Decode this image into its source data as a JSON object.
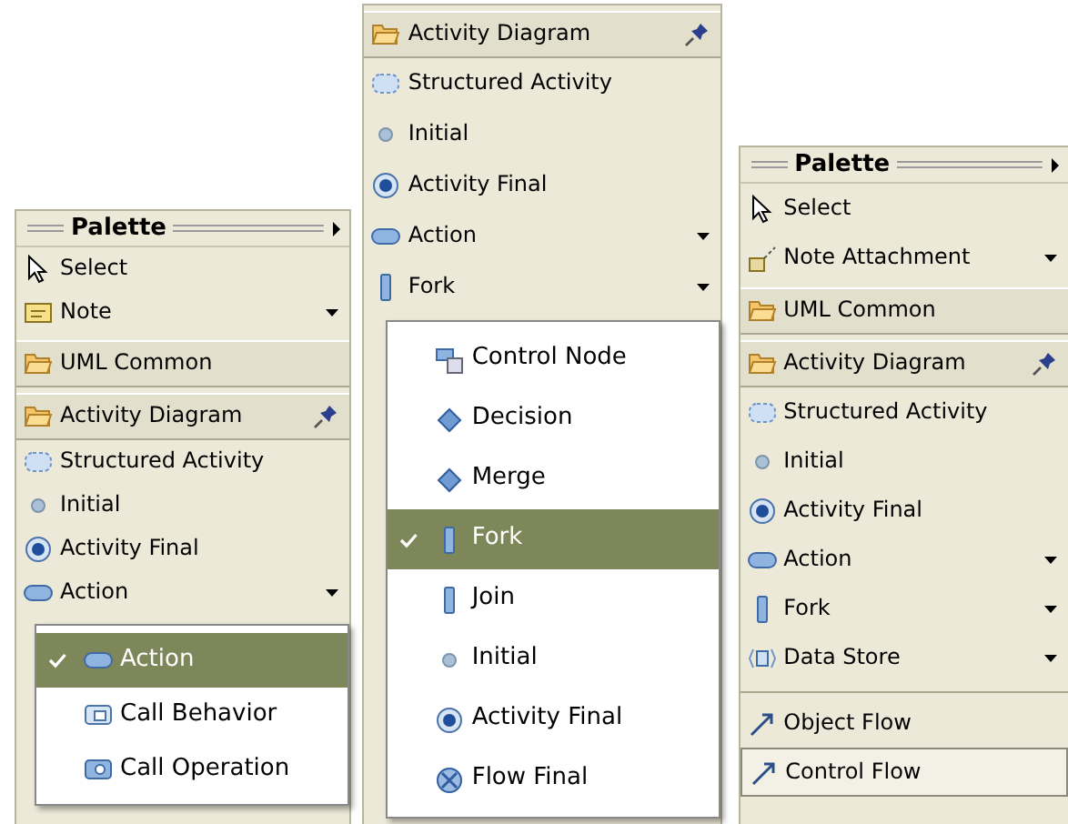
{
  "panels": [
    {
      "title": "Palette",
      "items": [
        {
          "kind": "select",
          "label": "Select",
          "dropdown": false,
          "selected": false
        },
        {
          "kind": "note",
          "label": "Note",
          "dropdown": true,
          "selected": false
        },
        {
          "kind": "drawer",
          "label": "UML Common",
          "pinned": false
        },
        {
          "kind": "drawer",
          "label": "Activity Diagram",
          "pinned": true
        },
        {
          "kind": "structured",
          "label": "Structured Activity",
          "dropdown": false,
          "selected": false
        },
        {
          "kind": "initial",
          "label": "Initial",
          "dropdown": false,
          "selected": false
        },
        {
          "kind": "final",
          "label": "Activity Final",
          "dropdown": false,
          "selected": false
        },
        {
          "kind": "action",
          "label": "Action",
          "dropdown": true,
          "selected": false
        }
      ],
      "menu": [
        {
          "kind": "action",
          "label": "Action",
          "selected": true
        },
        {
          "kind": "call-behavior",
          "label": "Call Behavior",
          "selected": false
        },
        {
          "kind": "call-operation",
          "label": "Call Operation",
          "selected": false
        }
      ]
    },
    {
      "items": [
        {
          "kind": "drawer",
          "label": "Activity Diagram",
          "pinned": true
        },
        {
          "kind": "structured",
          "label": "Structured Activity",
          "dropdown": false,
          "selected": false
        },
        {
          "kind": "initial",
          "label": "Initial",
          "dropdown": false,
          "selected": false
        },
        {
          "kind": "final",
          "label": "Activity Final",
          "dropdown": false,
          "selected": false
        },
        {
          "kind": "action",
          "label": "Action",
          "dropdown": true,
          "selected": false
        },
        {
          "kind": "fork",
          "label": "Fork",
          "dropdown": true,
          "selected": false
        }
      ],
      "menu": [
        {
          "kind": "control-node",
          "label": "Control Node",
          "selected": false
        },
        {
          "kind": "decision",
          "label": "Decision",
          "selected": false
        },
        {
          "kind": "decision",
          "label": "Merge",
          "selected": false
        },
        {
          "kind": "fork",
          "label": "Fork",
          "selected": true
        },
        {
          "kind": "fork",
          "label": "Join",
          "selected": false
        },
        {
          "kind": "initial",
          "label": "Initial",
          "selected": false
        },
        {
          "kind": "final",
          "label": "Activity Final",
          "selected": false
        },
        {
          "kind": "flow-final",
          "label": "Flow Final",
          "selected": false
        }
      ]
    },
    {
      "title": "Palette",
      "items": [
        {
          "kind": "select",
          "label": "Select",
          "dropdown": false,
          "selected": false
        },
        {
          "kind": "note-attachment",
          "label": "Note Attachment",
          "dropdown": true,
          "selected": false
        },
        {
          "kind": "drawer",
          "label": "UML Common",
          "pinned": false
        },
        {
          "kind": "drawer",
          "label": "Activity Diagram",
          "pinned": true
        },
        {
          "kind": "structured",
          "label": "Structured Activity",
          "dropdown": false,
          "selected": false
        },
        {
          "kind": "initial",
          "label": "Initial",
          "dropdown": false,
          "selected": false
        },
        {
          "kind": "final",
          "label": "Activity Final",
          "dropdown": false,
          "selected": false
        },
        {
          "kind": "action",
          "label": "Action",
          "dropdown": true,
          "selected": false
        },
        {
          "kind": "fork",
          "label": "Fork",
          "dropdown": true,
          "selected": false
        },
        {
          "kind": "datastore",
          "label": "Data Store",
          "dropdown": true,
          "selected": false
        },
        {
          "kind": "separator"
        },
        {
          "kind": "flow",
          "label": "Object Flow",
          "dropdown": false,
          "selected": false
        },
        {
          "kind": "flow",
          "label": "Control Flow",
          "dropdown": false,
          "selected": true
        }
      ]
    }
  ]
}
